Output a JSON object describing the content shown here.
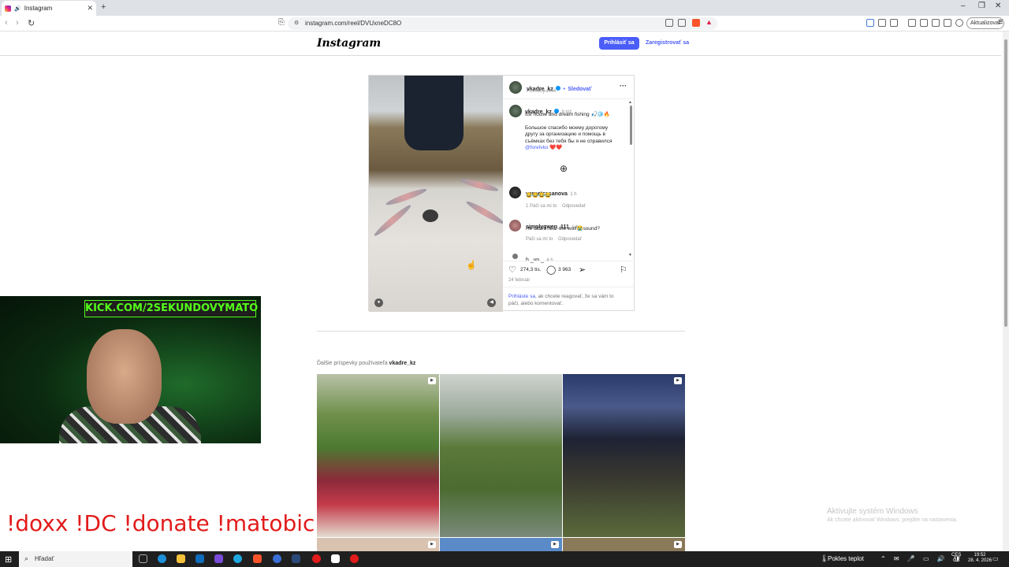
{
  "browser": {
    "tab_title": "Instagram",
    "new_tab": "+",
    "url": "instagram.com/reel/DVUxneDC8O",
    "update_label": "Aktualizovať",
    "min": "–",
    "restore": "❐",
    "close": "✕"
  },
  "ig_header": {
    "logo": "Instagram",
    "login": "Prihlásiť sa",
    "signup": "Zaregistrovať sa"
  },
  "post": {
    "author": "vkadre_kz",
    "follow": "Sledovať",
    "audio": "Pôvodný zvuk",
    "caption_user": "vkadre_kz",
    "caption_time": "9 týž.",
    "caption_line1": "Ice house and dream fishing 🎣🧊🔥",
    "caption_ru1": "Большое спасибо моему дорогому",
    "caption_ru2": "другу за организацию и помощь в",
    "caption_ru3": "съёмках без тебя бы я не справился",
    "caption_mention": "@forelvko",
    "caption_end": "❤️❤️",
    "comments": [
      {
        "user": "vernetcasanova",
        "time": "1 h",
        "text": "😂😂😂😂",
        "likes": "1 Páči sa mi to",
        "reply": "Odpovedať"
      },
      {
        "user": "simplygwen_111",
        "time": "1 h",
        "text": "He didn't hear the wolf😭sound?",
        "likes": "Páči sa mi to",
        "reply": "Odpovedať"
      },
      {
        "user": "h._vn._",
        "time": "4 h",
        "text": "",
        "likes": "",
        "reply": ""
      }
    ],
    "likes_count": "274,3 tis.",
    "comments_count": "3 963",
    "date": "24 február",
    "login_prompt_link": "Prihláste sa",
    "login_prompt_rest": ", ak chcete reagovať, že sa vám to",
    "login_prompt_rest2": "páči, alebo komentovať."
  },
  "more": {
    "prefix": "Ďalšie príspevky používateľa",
    "user": "vkadre_kz"
  },
  "stream": {
    "banner": "KICK.COM/2SEKUNDOVYMATO",
    "commands": "!doxx  !DC !donate !matobic"
  },
  "windows": {
    "watermark_title": "Aktivujte systém Windows",
    "watermark_sub": "Ak chcete aktivovať Windows, prejdite na nastavenia.",
    "search": "Hľadať",
    "weather": "Pokles teplot",
    "lang1": "CES",
    "lang2": "CS",
    "time": "19:52",
    "date": "28. 4. 2026"
  }
}
